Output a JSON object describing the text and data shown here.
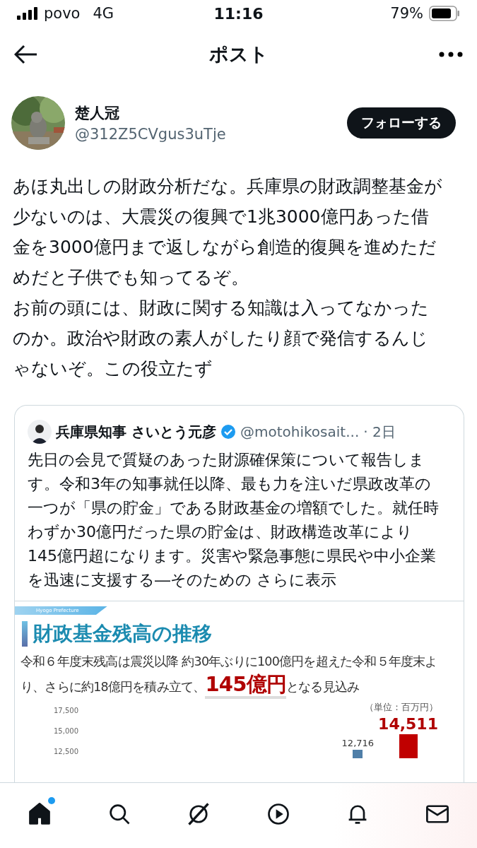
{
  "status_bar": {
    "carrier": "povo",
    "network": "4G",
    "time": "11:16",
    "battery": "79%"
  },
  "header": {
    "title": "ポスト"
  },
  "post": {
    "author": {
      "name": "楚人冠",
      "handle": "@312Z5CVgus3uTje"
    },
    "follow_button": "フォローする",
    "paragraphs": [
      "あほ丸出しの財政分析だな。兵庫県の財政調整基金が少ないのは、大震災の復興で1兆3000億円あった借金を3000億円まで返しながら創造的復興を進めただめだと子供でも知ってるぞ。",
      "お前の頭には、財政に関する知識は入ってなかったのか。政治や財政の素人がしたり顔で発信するんじゃないぞ。この役立たず"
    ]
  },
  "quoted_post": {
    "author": {
      "name": "兵庫県知事 さいとう元彦",
      "verified": true,
      "handle": "@motohikosait...",
      "time": "· 2日"
    },
    "text": "先日の会見で質疑のあった財源確保策について報告します。令和3年の知事就任以降、最も力を注いだ県政改革の一つが「県の貯金」である財政基金の増額でした。就任時わずか30億円だった県の貯金は、財政構造改革により145億円超になります。災害や緊急事態に県民や中小企業を迅速に支援する―そのための",
    "more_link": "さらに表示",
    "slide": {
      "tag": "Hyogo Prefecture",
      "title": "財政基金残高の推移",
      "summary": "令和６年度末残高は震災以降 約30年ぶりに100億円を超えた令和５年度末より、さらに約18億円を積み立て、**145億円**となる見込み",
      "unit": "（単位：百万円）",
      "axis_labels": [
        "17,500",
        "15,000",
        "12,500"
      ],
      "bars": [
        {
          "label": "12,716",
          "color": "#4f7fa8"
        },
        {
          "label": "14,511",
          "color": "#c00000"
        }
      ]
    }
  },
  "nav": [
    {
      "kind": "home",
      "selected": true,
      "dot": true
    },
    {
      "kind": "search",
      "selected": false,
      "dot": false
    },
    {
      "kind": "grok",
      "selected": false,
      "dot": false
    },
    {
      "kind": "video",
      "selected": false,
      "dot": false
    },
    {
      "kind": "bell",
      "selected": false,
      "dot": false
    },
    {
      "kind": "mail",
      "selected": false,
      "dot": false
    }
  ]
}
